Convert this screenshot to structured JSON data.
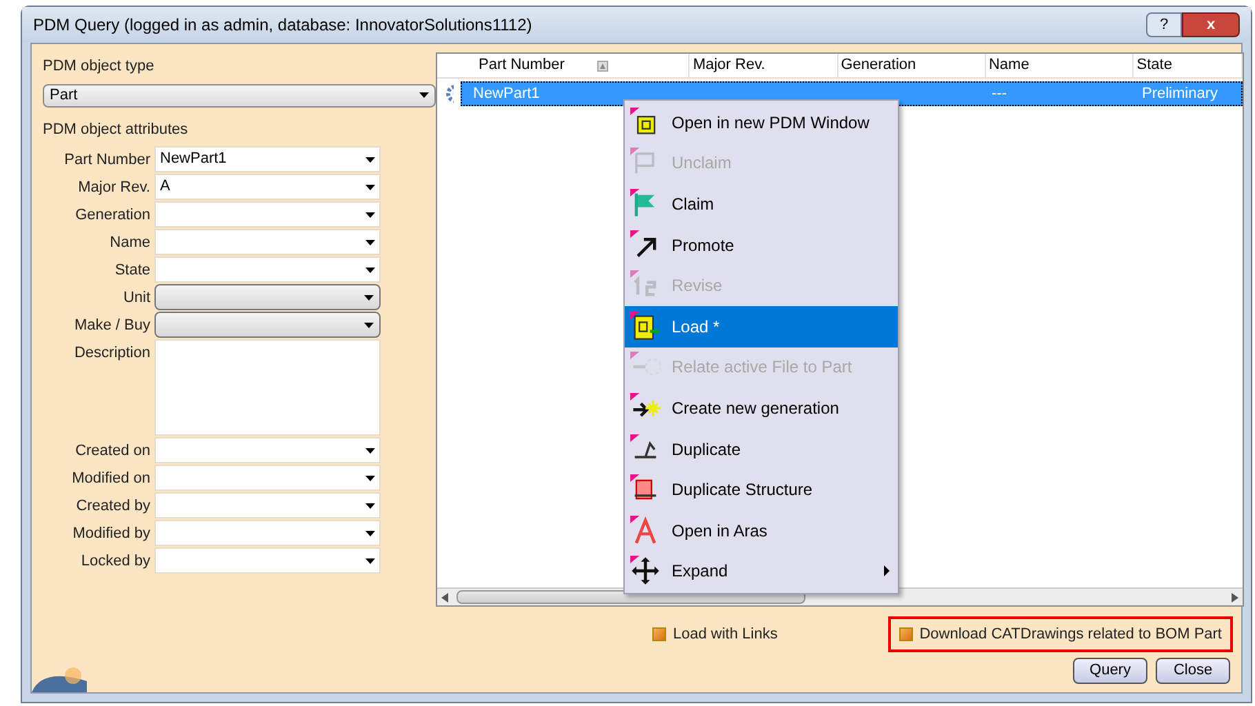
{
  "window": {
    "title": "PDM Query (logged in as admin, database: InnovatorSolutions1112)",
    "help_button": "?",
    "close_button": "x"
  },
  "object_type": {
    "label": "PDM object type",
    "value": "Part"
  },
  "attributes": {
    "label": "PDM object attributes",
    "fields": [
      {
        "label": "Part Number",
        "kind": "combo",
        "value": "NewPart1"
      },
      {
        "label": "Major Rev.",
        "kind": "combo",
        "value": "A"
      },
      {
        "label": "Generation",
        "kind": "combo"
      },
      {
        "label": "Name",
        "kind": "combo"
      },
      {
        "label": "State",
        "kind": "combo"
      },
      {
        "label": "Unit",
        "kind": "dropdown"
      },
      {
        "label": "Make / Buy",
        "kind": "dropdown"
      },
      {
        "label": "Description",
        "kind": "textarea"
      },
      {
        "label": "Created on",
        "kind": "combo"
      },
      {
        "label": "Modified on",
        "kind": "combo"
      },
      {
        "label": "Created by",
        "kind": "combo"
      },
      {
        "label": "Modified by",
        "kind": "combo"
      },
      {
        "label": "Locked by",
        "kind": "combo"
      }
    ]
  },
  "table": {
    "columns": [
      "Part Number",
      "Major Rev.",
      "Generation",
      "Name",
      "State"
    ],
    "rows": [
      {
        "selected": true,
        "cells": [
          "NewPart1",
          "",
          "",
          "---",
          "Preliminary"
        ]
      }
    ]
  },
  "context_menu": [
    {
      "label": "Open in new PDM Window",
      "disabled": false,
      "selected": false
    },
    {
      "label": "Unclaim",
      "disabled": true,
      "selected": false
    },
    {
      "label": "Claim",
      "disabled": false,
      "selected": false
    },
    {
      "label": "Promote",
      "disabled": false,
      "selected": false
    },
    {
      "label": "Revise",
      "disabled": true,
      "selected": false
    },
    {
      "label": "Load *",
      "disabled": false,
      "selected": true
    },
    {
      "label": "Relate active File to Part",
      "disabled": true,
      "selected": false
    },
    {
      "label": "Create new generation",
      "disabled": false,
      "selected": false
    },
    {
      "label": "Duplicate",
      "disabled": false,
      "selected": false
    },
    {
      "label": "Duplicate Structure",
      "disabled": false,
      "selected": false
    },
    {
      "label": "Open in Aras",
      "disabled": false,
      "selected": false
    },
    {
      "label": "Expand",
      "disabled": false,
      "selected": false,
      "submenu": true
    }
  ],
  "options": [
    {
      "label": "Load with Links",
      "checked": true
    },
    {
      "label": "Download CATDrawings related to BOM Part",
      "checked": true,
      "highlighted": true
    }
  ],
  "buttons": [
    "Query",
    "Close"
  ]
}
